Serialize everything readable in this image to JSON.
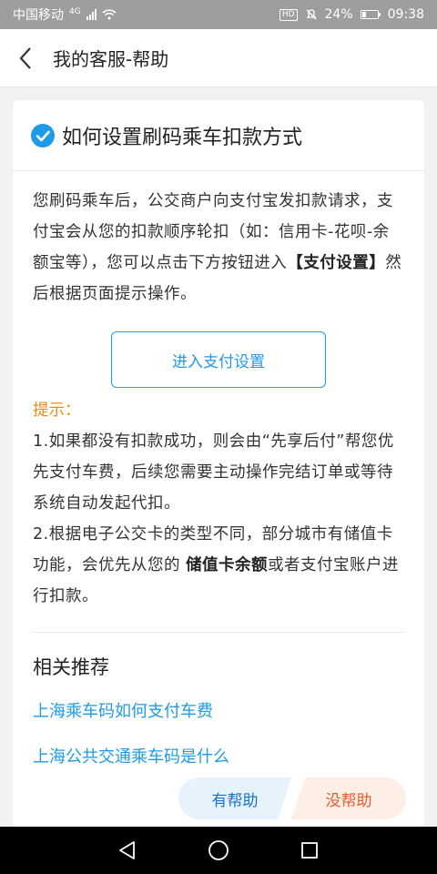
{
  "status_bar": {
    "carrier": "中国移动",
    "network": "4G",
    "hd": "HD",
    "battery_percent": "24%",
    "battery_level": 0.24,
    "time": "09:38"
  },
  "nav": {
    "back_icon": "chevron-left-icon",
    "title": "我的客服-帮助"
  },
  "question": {
    "check_icon": "check-circle-icon",
    "title": "如何设置刷码乘车扣款方式",
    "answer_part1": "您刷码乘车后，公交商户向支付宝发扣款请求，支付宝会从您的扣款顺序轮扣（如：信用卡-花呗-余额宝等），您可以点击下方按钮进入",
    "answer_bold": "【支付设置】",
    "answer_part2": "然后根据页面提示操作。",
    "cta_label": "进入支付设置",
    "tip_label": "提示：",
    "tip1": "1.如果都没有扣款成功，则会由“先享后付”帮您优先支付车费，后续您需要主动操作完结订单或等待系统自动发起代扣。",
    "tip2_part1": "2.根据电子公交卡的类型不同，部分城市有储值卡功能，会优先从您的 ",
    "tip2_bold": "储值卡余额",
    "tip2_part2": "或者支付宝账户进行扣款。"
  },
  "related": {
    "title": "相关推荐",
    "links": [
      "上海乘车码如何支付车费",
      "上海公共交通乘车码是什么"
    ]
  },
  "feedback": {
    "helpful": "有帮助",
    "not_helpful": "没帮助"
  },
  "system_nav": {
    "back": "triangle-back-icon",
    "home": "circle-home-icon",
    "recents": "square-recents-icon"
  },
  "colors": {
    "accent_blue": "#1e9be6",
    "tip_orange": "#f08a16",
    "negative_orange": "#e85a2b",
    "status_bar_gray": "#9e9e9e"
  }
}
